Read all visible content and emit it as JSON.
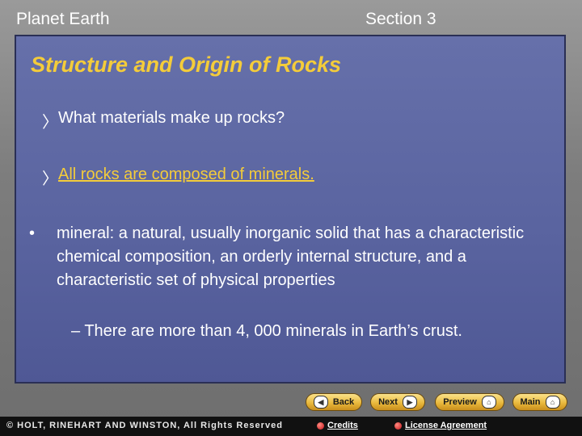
{
  "header": {
    "chapter": "Planet Earth",
    "section": "Section 3"
  },
  "slide": {
    "title": "Structure and Origin of Rocks",
    "question": "What materials make up rocks?",
    "answer": "All rocks are composed of minerals.",
    "definition": "mineral: a natural, usually inorganic solid that has a characteristic chemical composition, an orderly internal structure, and a characteristic set of physical properties",
    "sub_point": "– There are more than 4, 000 minerals in Earth’s crust."
  },
  "nav": {
    "back": "Back",
    "next": "Next",
    "preview": "Preview",
    "main": "Main"
  },
  "footer": {
    "copyright": "© HOLT, RINEHART AND WINSTON, All Rights Reserved",
    "credits": "Credits",
    "license": "License Agreement"
  },
  "colors": {
    "accent": "#f4cc3a",
    "slide_bg": "#5a64a0",
    "nav_button": "#e9b93d"
  }
}
